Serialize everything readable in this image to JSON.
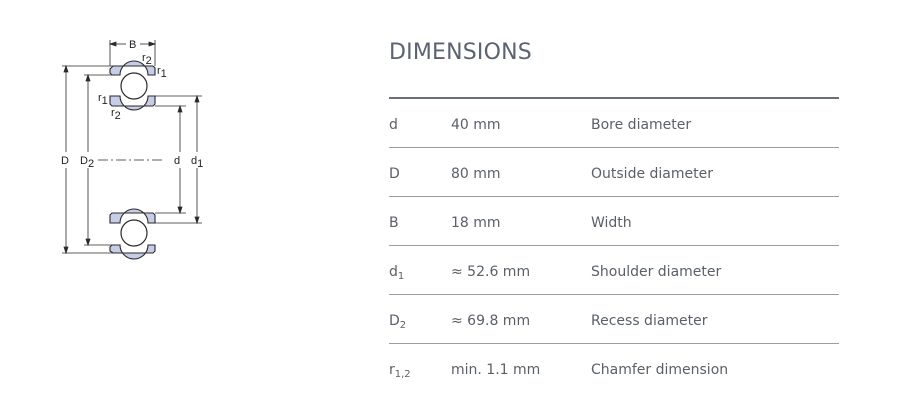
{
  "diagram": {
    "labels": {
      "B": "B",
      "r2_top": "r",
      "r2_top_sub": "2",
      "r1_top": "r",
      "r1_top_sub": "1",
      "r1_left": "r",
      "r1_left_sub": "1",
      "r2_inner": "r",
      "r2_inner_sub": "2",
      "D": "D",
      "D2": "D",
      "D2_sub": "2",
      "d": "d",
      "d1": "d",
      "d1_sub": "1"
    }
  },
  "section": {
    "title": "DIMENSIONS"
  },
  "rows": [
    {
      "symbol": "d",
      "symbol_sub": "",
      "value": "40 mm",
      "description": "Bore diameter"
    },
    {
      "symbol": "D",
      "symbol_sub": "",
      "value": "80 mm",
      "description": "Outside diameter"
    },
    {
      "symbol": "B",
      "symbol_sub": "",
      "value": "18 mm",
      "description": "Width"
    },
    {
      "symbol": "d",
      "symbol_sub": "1",
      "value": "≈ 52.6 mm",
      "description": "Shoulder diameter"
    },
    {
      "symbol": "D",
      "symbol_sub": "2",
      "value": "≈ 69.8 mm",
      "description": "Recess diameter"
    },
    {
      "symbol": "r",
      "symbol_sub": "1,2",
      "value": "min. 1.1 mm",
      "description": "Chamfer dimension"
    }
  ],
  "colors": {
    "ring_fill": "#c7cde6",
    "ball_fill": "#ffffff",
    "line": "#2a2a2a"
  }
}
